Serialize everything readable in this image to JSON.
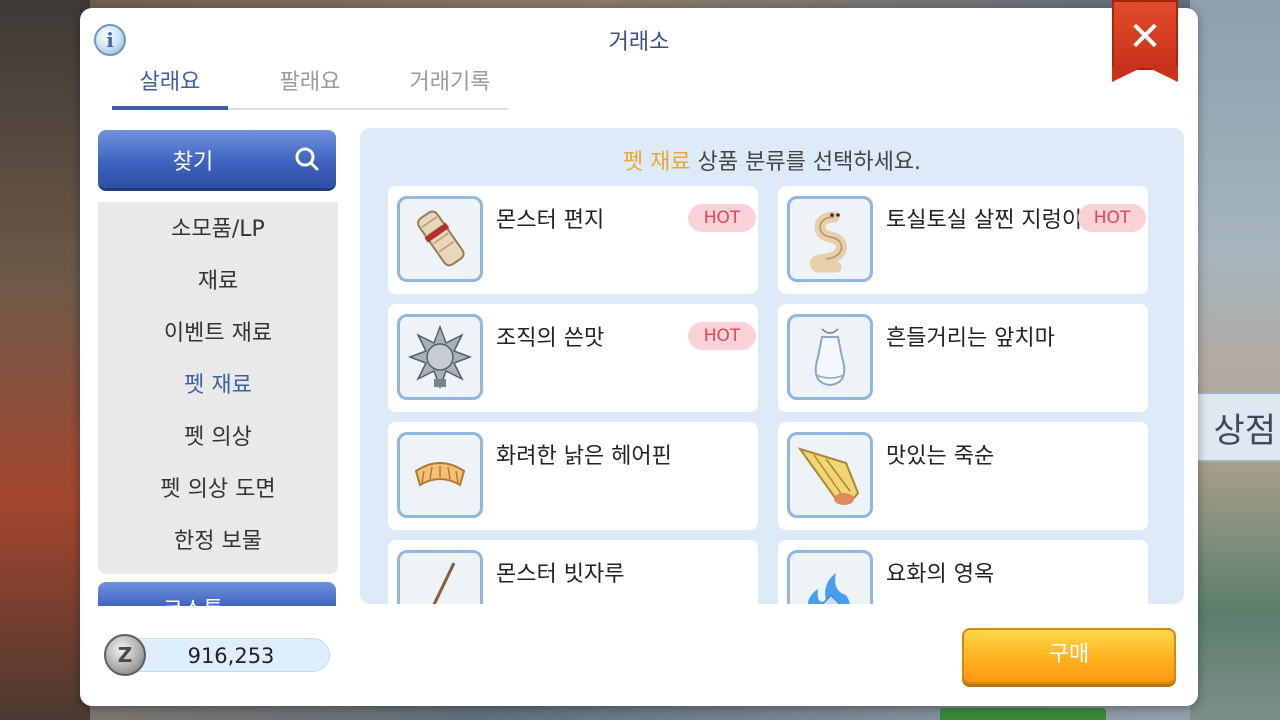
{
  "dialog": {
    "title": "거래소",
    "tabs": [
      {
        "label": "살래요",
        "active": true
      },
      {
        "label": "팔래요",
        "active": false
      },
      {
        "label": "거래기록",
        "active": false
      }
    ],
    "info_icon": "info-icon",
    "close_icon": "close-icon"
  },
  "sidebar": {
    "search_label": "찾기",
    "search_icon": "search-icon",
    "categories": [
      {
        "label": "소모품/LP"
      },
      {
        "label": "재료"
      },
      {
        "label": "이벤트 재료"
      },
      {
        "label": "펫 재료",
        "active": true
      },
      {
        "label": "펫 의상"
      },
      {
        "label": "펫 의상 도면"
      },
      {
        "label": "한정 보물"
      }
    ],
    "collapsed_label": "코스튬"
  },
  "content": {
    "prompt_highlight": "펫 재료",
    "prompt_rest": " 상품 분류를 선택하세요.",
    "items": [
      {
        "name": "몬스터 편지",
        "hot": "HOT",
        "icon": "scroll-letter-icon"
      },
      {
        "name": "토실토실 살찐 지렁이",
        "hot": "HOT",
        "icon": "worm-icon"
      },
      {
        "name": "조직의 쓴맛",
        "hot": "HOT",
        "icon": "spiked-ball-icon"
      },
      {
        "name": "흔들거리는 앞치마",
        "hot": "",
        "icon": "apron-icon"
      },
      {
        "name": "화려한 낡은 헤어핀",
        "hot": "",
        "icon": "hairpin-icon"
      },
      {
        "name": "맛있는 죽순",
        "hot": "",
        "icon": "bamboo-shoot-icon"
      },
      {
        "name": "몬스터 빗자루",
        "hot": "",
        "icon": "broom-icon"
      },
      {
        "name": "요화의 영옥",
        "hot": "",
        "icon": "blue-flame-gem-icon"
      }
    ]
  },
  "footer": {
    "zeny_icon": "zeny-coin-icon",
    "zeny_symbol": "Z",
    "zeny_amount": "916,253",
    "buy_label": "구매"
  },
  "background": {
    "shop_sign": "상점"
  },
  "colors": {
    "accent_blue": "#3d5fa3",
    "highlight_orange": "#f2a431",
    "hot_badge_bg": "#f8d2d6",
    "hot_badge_text": "#e0455a",
    "close_red": "#d63a20",
    "buy_orange": "#ffb11f"
  }
}
